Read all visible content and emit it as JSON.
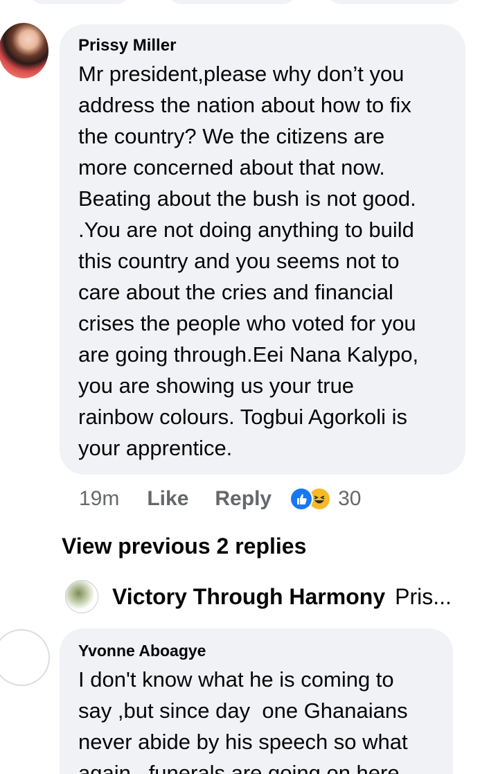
{
  "comments": [
    {
      "author": "Prissy Miller",
      "text": "Mr president,please why don’t you\naddress the nation about how to fix\nthe country? We the citizens are\nmore concerned about that now.\nBeating about the bush is not good.\n.You are not doing anything to build\nthis country and you seems not to\ncare about the cries and financial\ncrises the people who voted for you\nare going through.Eei Nana Kalypo,\nyou are showing us your true\nrainbow colours. Togbui Agorkoli is\nyour apprentice.",
      "time": "19m",
      "like_label": "Like",
      "reply_label": "Reply",
      "reaction_icons": [
        "like-icon",
        "haha-icon"
      ],
      "reaction_count": "30"
    },
    {
      "author": "Yvonne Aboagye",
      "text": "I don't know what he is coming to\nsay ,but since day  one Ghanaians\nnever abide by his speech so what\nagain , funerals are going on here"
    }
  ],
  "view_previous_replies": "View previous 2 replies",
  "latest_reply": {
    "author": "Victory Through Harmony",
    "preview": "Pris..."
  },
  "colors": {
    "bubble": "#f0f2f5",
    "meta": "#65676b",
    "like": "#1877f2",
    "haha": "#f7b928"
  }
}
